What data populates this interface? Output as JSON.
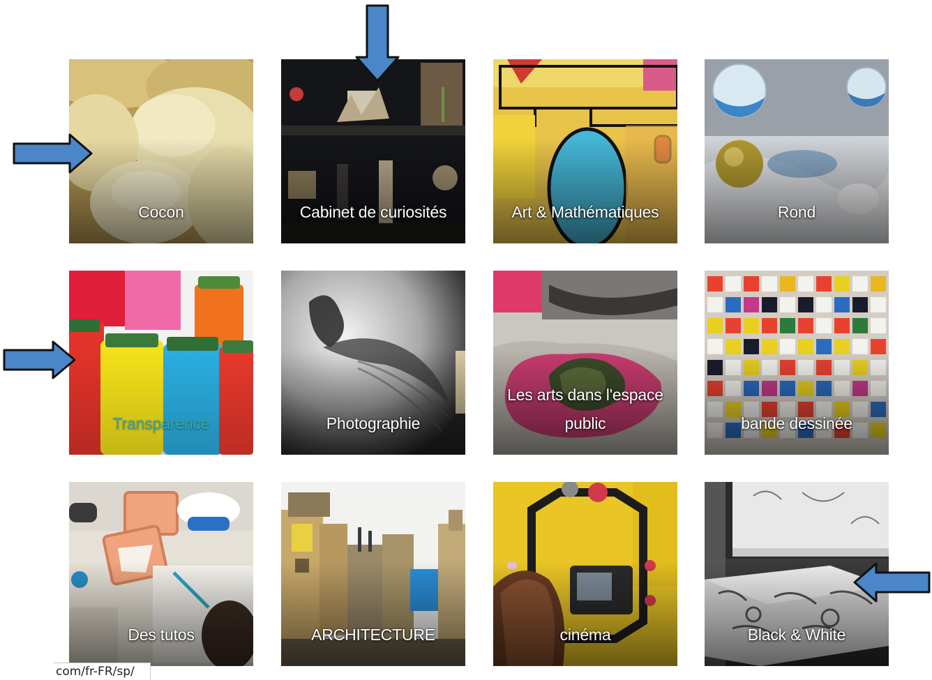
{
  "tiles": [
    {
      "label": "Cocon",
      "icon": "silk-cocoons-image"
    },
    {
      "label": "Cabinet de curiosités",
      "icon": "curiosity-shelf-image"
    },
    {
      "label": "Art & Mathématiques",
      "icon": "geometric-drawing-image"
    },
    {
      "label": "Rond",
      "icon": "glass-spheres-image"
    },
    {
      "label": "Transparence",
      "icon": "colored-jars-image"
    },
    {
      "label": "Photographie",
      "icon": "shadow-photo-image"
    },
    {
      "label": "Les arts dans l'espace public",
      "icon": "public-art-installation-image"
    },
    {
      "label": "bande dessinée",
      "icon": "comic-panels-image"
    },
    {
      "label": "Des tutos",
      "icon": "craft-table-image"
    },
    {
      "label": "ARCHITECTURE",
      "icon": "model-buildings-image"
    },
    {
      "label": "cinéma",
      "icon": "camera-rig-image"
    },
    {
      "label": "Black & White",
      "icon": "black-white-bench-image"
    }
  ],
  "status_bar": {
    "url": "com/fr-FR/sp/"
  },
  "annotations": {
    "arrow_color": "#4a86c8",
    "arrow_outline": "#111111"
  },
  "colors": {
    "highlight_label": "#3aa6a0"
  }
}
